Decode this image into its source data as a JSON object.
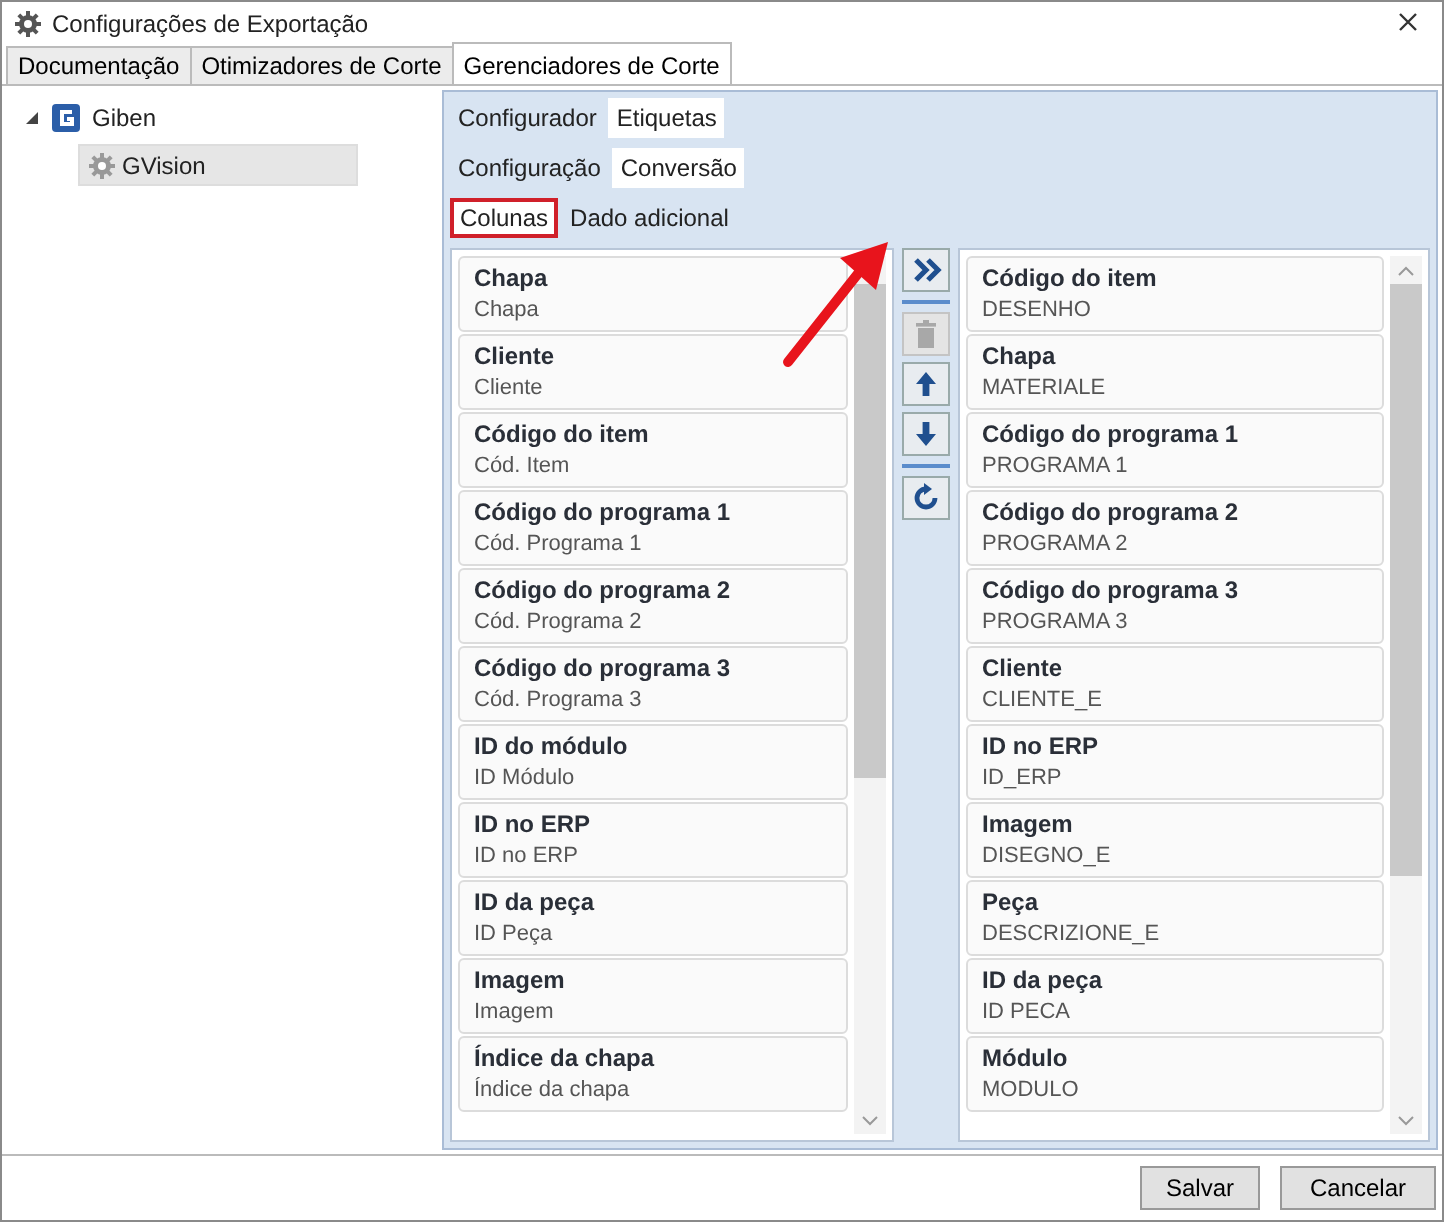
{
  "window": {
    "title": "Configurações de Exportação"
  },
  "tabs": [
    {
      "label": "Documentação",
      "selected": false
    },
    {
      "label": "Otimizadores de Corte",
      "selected": false
    },
    {
      "label": "Gerenciadores de Corte",
      "selected": true
    }
  ],
  "tree": [
    {
      "label": "Giben",
      "kind": "brand",
      "expanded": true,
      "selected": false,
      "children": [
        {
          "label": "GVision",
          "kind": "gear",
          "selected": true
        }
      ]
    }
  ],
  "panel_tabs": [
    {
      "label": "Configurador",
      "selected": false
    },
    {
      "label": "Etiquetas",
      "selected": true
    }
  ],
  "sub_tabs": [
    {
      "label": "Configuração",
      "selected": false
    },
    {
      "label": "Conversão",
      "selected": true
    }
  ],
  "inner_tabs": [
    {
      "label": "Colunas",
      "selected": true,
      "highlighted": true
    },
    {
      "label": "Dado adicional",
      "selected": false,
      "highlighted": false
    }
  ],
  "source_list": [
    {
      "title": "Chapa",
      "value": "Chapa"
    },
    {
      "title": "Cliente",
      "value": "Cliente"
    },
    {
      "title": "Código do item",
      "value": "Cód. Item"
    },
    {
      "title": "Código do programa 1",
      "value": "Cód. Programa 1"
    },
    {
      "title": "Código do programa 2",
      "value": "Cód. Programa 2"
    },
    {
      "title": "Código do programa 3",
      "value": "Cód. Programa 3"
    },
    {
      "title": "ID do módulo",
      "value": "ID Módulo"
    },
    {
      "title": "ID no ERP",
      "value": "ID no ERP"
    },
    {
      "title": "ID da peça",
      "value": "ID Peça"
    },
    {
      "title": "Imagem",
      "value": "Imagem"
    },
    {
      "title": "Índice da chapa",
      "value": "Índice da chapa"
    }
  ],
  "toolbar": [
    {
      "kind": "add",
      "disabled": false
    },
    {
      "kind": "delete",
      "disabled": true
    },
    {
      "kind": "up",
      "disabled": false
    },
    {
      "kind": "down",
      "disabled": false
    },
    {
      "kind": "reset",
      "disabled": false
    }
  ],
  "target_list": [
    {
      "title": "Código do item",
      "value": "DESENHO"
    },
    {
      "title": "Chapa",
      "value": "MATERIALE"
    },
    {
      "title": "Código do programa 1",
      "value": "PROGRAMA 1"
    },
    {
      "title": "Código do programa 2",
      "value": "PROGRAMA 2"
    },
    {
      "title": "Código do programa 3",
      "value": "PROGRAMA 3"
    },
    {
      "title": "Cliente",
      "value": "CLIENTE_E"
    },
    {
      "title": "ID no ERP",
      "value": "ID_ERP"
    },
    {
      "title": "Imagem",
      "value": "DISEGNO_E"
    },
    {
      "title": "Peça",
      "value": "DESCRIZIONE_E"
    },
    {
      "title": "ID da peça",
      "value": "ID PECA"
    },
    {
      "title": "Módulo",
      "value": "MODULO"
    }
  ],
  "annotations": [
    {
      "kind": "arrow"
    }
  ],
  "buttons": [
    "Salvar",
    "Cancelar"
  ]
}
